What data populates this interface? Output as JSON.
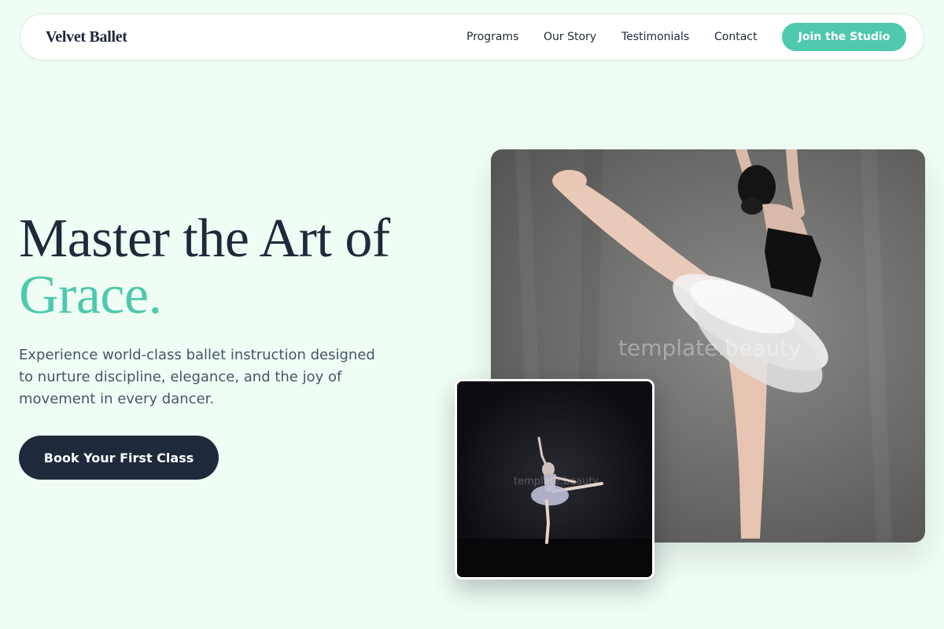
{
  "nav": {
    "brand": "Velvet Ballet",
    "links": [
      "Programs",
      "Our Story",
      "Testimonials",
      "Contact"
    ],
    "cta_label": "Join the Studio"
  },
  "hero": {
    "title_line1": "Master the Art of",
    "title_accent": "Grace.",
    "subtitle": "Experience world-class ballet instruction designed to nurture discipline, elegance, and the joy of movement in every dancer.",
    "cta_label": "Book Your First Class"
  },
  "images": {
    "main_watermark": "template.beauty",
    "small_watermark": "template.beauty"
  },
  "colors": {
    "accent": "#4fc9ad",
    "dark": "#1e293b",
    "background": "#f0fdf4"
  }
}
